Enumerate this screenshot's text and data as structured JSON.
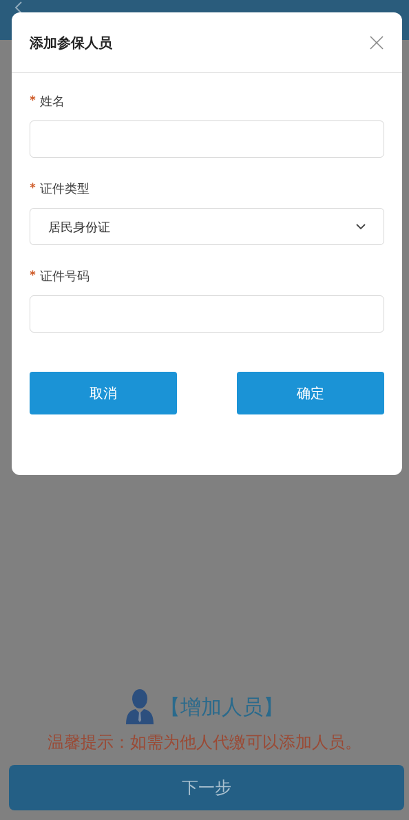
{
  "background": {
    "add_person": "【增加人员】",
    "tip": "温馨提示：如需为他人代缴可以添加人员。",
    "next_button": "下一步"
  },
  "dialog": {
    "title": "添加参保人员",
    "fields": [
      {
        "kind": "text",
        "label": "姓名",
        "required": true
      },
      {
        "kind": "select",
        "label": "证件类型",
        "required": true,
        "value": "居民身份证"
      },
      {
        "kind": "text",
        "label": "证件号码",
        "required": true
      }
    ],
    "buttons": [
      "取消",
      "确定"
    ]
  }
}
